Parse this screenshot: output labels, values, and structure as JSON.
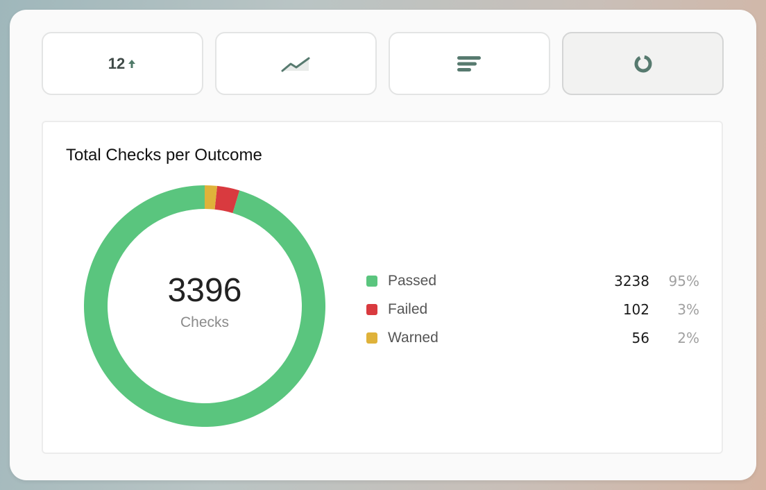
{
  "tabs": [
    {
      "label": "12",
      "icon": "arrow-up-icon",
      "active": false
    },
    {
      "label": "",
      "icon": "line-chart-icon",
      "active": false
    },
    {
      "label": "",
      "icon": "bar-list-icon",
      "active": false
    },
    {
      "label": "",
      "icon": "donut-chart-icon",
      "active": true
    }
  ],
  "panel": {
    "title": "Total Checks per Outcome",
    "center_value": "3396",
    "center_label": "Checks"
  },
  "legend": [
    {
      "name": "Passed",
      "count": "3238",
      "percent": "95%",
      "color": "#5ac57e"
    },
    {
      "name": "Failed",
      "count": "102",
      "percent": "3%",
      "color": "#d93a3f"
    },
    {
      "name": "Warned",
      "count": "56",
      "percent": "2%",
      "color": "#dfb23a"
    }
  ],
  "colors": {
    "accent": "#577a6f",
    "passed": "#5ac57e",
    "failed": "#d93a3f",
    "warned": "#dfb23a"
  },
  "chart_data": {
    "type": "pie",
    "categories": [
      "Passed",
      "Failed",
      "Warned"
    ],
    "values": [
      3238,
      102,
      56
    ],
    "title": "Total Checks per Outcome",
    "total": 3396,
    "legend": "right"
  }
}
